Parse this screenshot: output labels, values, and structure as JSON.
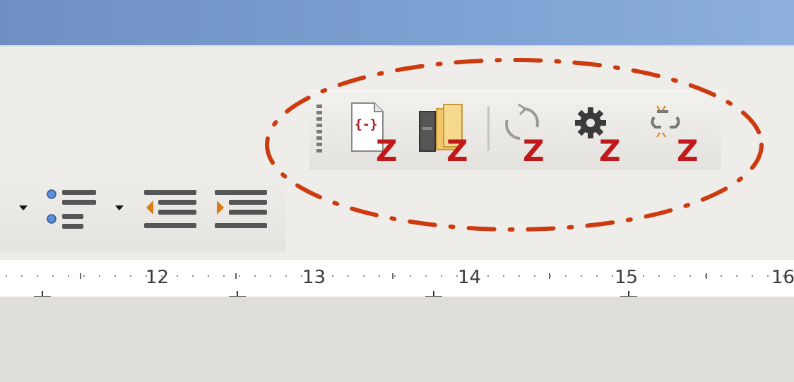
{
  "zotero_toolbar": {
    "buttons": [
      {
        "name": "insert-citation",
        "icon": "document-citation-z-icon",
        "badge": "Z"
      },
      {
        "name": "insert-bibliography",
        "icon": "books-z-icon",
        "badge": "Z"
      },
      {
        "name": "refresh",
        "icon": "refresh-z-icon",
        "badge": "Z"
      },
      {
        "name": "document-preferences",
        "icon": "gear-z-icon",
        "badge": "Z"
      },
      {
        "name": "unlink-citations",
        "icon": "unlink-z-icon",
        "badge": "Z"
      }
    ]
  },
  "ruler": {
    "labels": [
      "12",
      "13",
      "14",
      "15",
      "16"
    ]
  },
  "colors": {
    "badge": "#c0181b",
    "annotation": "#cc3a0e",
    "titlebar": "#7ea2d3"
  }
}
